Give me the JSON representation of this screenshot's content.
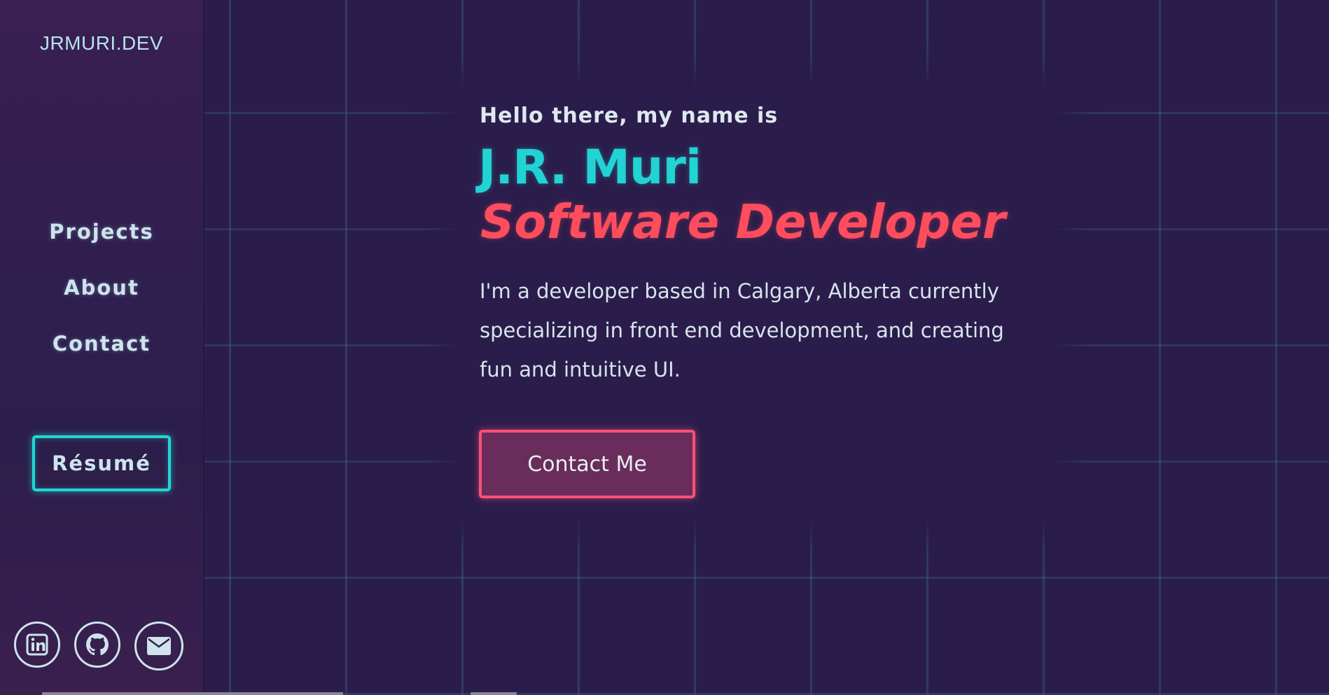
{
  "sidebar": {
    "logo": "JRMURI.DEV",
    "nav": [
      {
        "label": "Projects"
      },
      {
        "label": "About"
      },
      {
        "label": "Contact"
      }
    ],
    "resume_label": "Résumé",
    "socials": [
      {
        "icon": "linkedin-icon"
      },
      {
        "icon": "github-icon"
      },
      {
        "icon": "mail-icon"
      }
    ]
  },
  "hero": {
    "greeting": "Hello there, my name is",
    "name": "J.R. Muri",
    "role": "Software Developer",
    "bio": "I'm a developer based in Calgary, Alberta currently specializing in front end development, and creating fun and intuitive UI.",
    "contact_label": "Contact Me"
  },
  "colors": {
    "background": "#2b1d4b",
    "accent_cyan": "#22d3d3",
    "accent_red": "#ff4d5e",
    "button_border": "#ff4f7a"
  }
}
